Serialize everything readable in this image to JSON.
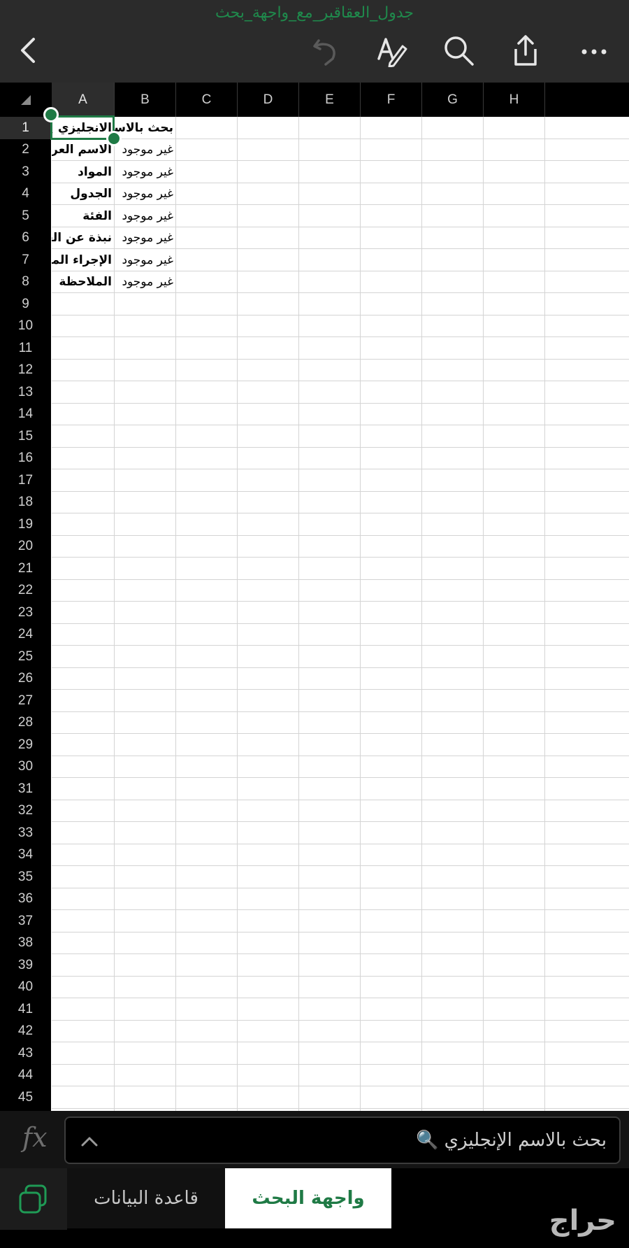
{
  "document": {
    "title": "جدول_العقاقير_مع_واجهة_بحث"
  },
  "toolbar": {
    "icons": [
      "back-icon",
      "undo-icon",
      "format-text-icon",
      "search-icon",
      "share-icon",
      "more-icon"
    ]
  },
  "grid": {
    "columns": [
      "A",
      "B",
      "C",
      "D",
      "E",
      "F",
      "G",
      "H"
    ],
    "rows": [
      "1",
      "2",
      "3",
      "4",
      "5",
      "6",
      "7",
      "8",
      "9",
      "10",
      "11",
      "12",
      "13",
      "14",
      "15",
      "16",
      "17",
      "18",
      "19",
      "20",
      "21",
      "22",
      "23",
      "24",
      "25",
      "26",
      "27",
      "28",
      "29",
      "30",
      "31",
      "32",
      "33",
      "34",
      "35",
      "36",
      "37",
      "38",
      "39",
      "40",
      "41",
      "42",
      "43",
      "44",
      "45"
    ],
    "selected_cell": "A1",
    "cells": [
      {
        "ref": "A1",
        "text": "الانجليزي 🔍",
        "bold": true
      },
      {
        "ref": "B1",
        "text": "بحث بالاسم",
        "bold": true
      },
      {
        "ref": "A2",
        "text": "الاسم العربي",
        "bold": true
      },
      {
        "ref": "B2",
        "text": "غير موجود",
        "bold": false
      },
      {
        "ref": "A3",
        "text": "المواد",
        "bold": true
      },
      {
        "ref": "B3",
        "text": "غير موجود",
        "bold": false
      },
      {
        "ref": "A4",
        "text": "الجدول",
        "bold": true
      },
      {
        "ref": "B4",
        "text": "غير موجود",
        "bold": false
      },
      {
        "ref": "A5",
        "text": "الفئة",
        "bold": true
      },
      {
        "ref": "B5",
        "text": "غير موجود",
        "bold": false
      },
      {
        "ref": "A6",
        "text": "نبذة عن العقار",
        "bold": true
      },
      {
        "ref": "B6",
        "text": "غير موجود",
        "bold": false
      },
      {
        "ref": "A7",
        "text": "الإجراء المتخذ",
        "bold": true
      },
      {
        "ref": "B7",
        "text": "غير موجود",
        "bold": false
      },
      {
        "ref": "A8",
        "text": "الملاحظة",
        "bold": true
      },
      {
        "ref": "B8",
        "text": "غير موجود",
        "bold": false
      }
    ]
  },
  "formula_bar": {
    "label": "fx",
    "value": "بحث بالاسم الإنجليزي 🔍"
  },
  "sheets": {
    "inactive": "قاعدة البيانات",
    "active": "واجهة البحث"
  },
  "watermark": "حراج",
  "colors": {
    "accent": "#1f7a45",
    "title": "#1f8a4c",
    "toolbar": "#2b2b2b"
  }
}
